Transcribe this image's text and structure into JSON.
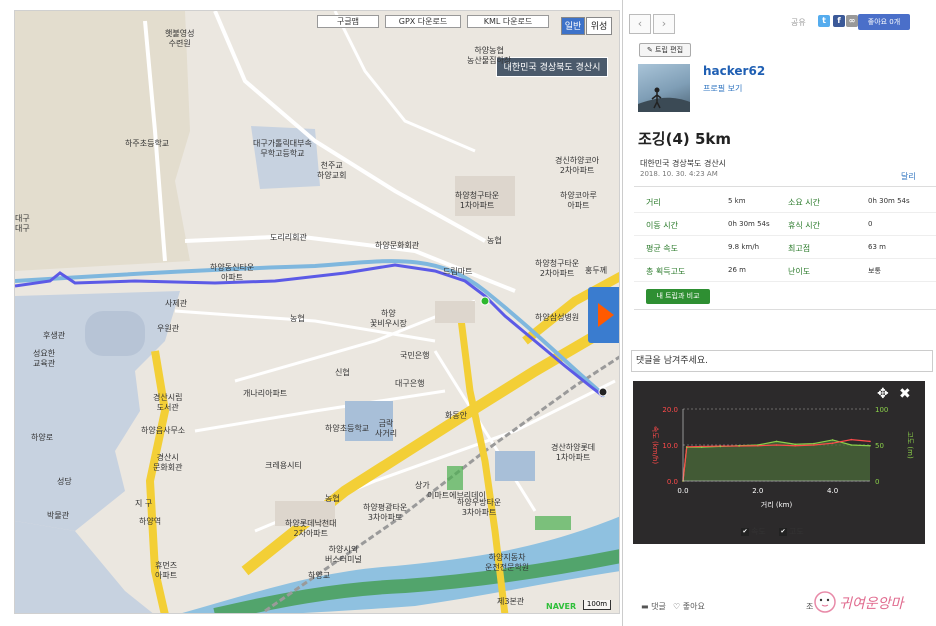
{
  "map": {
    "top_buttons": [
      "구글맵",
      "GPX 다운로드",
      "KML 다운로드"
    ],
    "map_types": [
      "일반",
      "위성"
    ],
    "selected_type": "일반",
    "popup": "대한민국 경상북도 경산시",
    "naver": "NAVER",
    "scale": "100m",
    "labels": [
      "햇불영성\n수련원",
      "하양농협\n농산물집하장",
      "하주초등학교",
      "대구가톨릭대부속\n무학고등학교",
      "천주교\n하양교회",
      "경신하양코아\n2차아파트",
      "하양청구타운\n1차아파트",
      "하양코아루\n아파트",
      "도리리회관",
      "하양문화회관",
      "농협",
      "하양청구타운\n2차아파트",
      "홍두께",
      "하양동신타운\n아파트",
      "드림마트",
      "하양삼성병원",
      "사제관",
      "농협",
      "후생관",
      "우원관",
      "하양\n꽃비우시장",
      "국민은행",
      "성요한\n교육관",
      "신협",
      "대구은행",
      "개나리아파트",
      "경산시립\n도서관",
      "하양읍사무소",
      "하양초등학교",
      "경산시\n문화회관",
      "크레용시티",
      "경산하양롯데\n1차아파트",
      "이마트에브리데이",
      "농협",
      "하양우방타운\n3차아파트",
      "하양역",
      "하양롯데낙천대\n2차아파트",
      "하양평광타운\n3차아파트",
      "하양시외\n버스터미널",
      "휴먼즈\n아파트",
      "하양교",
      "하양지동차\n운전전문학원",
      "제3본관",
      "성당",
      "박물관",
      "지 구",
      "대구\n대구",
      "하양로",
      "금락\n사거리",
      "화동안",
      "상가"
    ]
  },
  "panel": {
    "share_label": "공유",
    "like_label": "좋아요 0개",
    "edit_label": "트립 편집",
    "username": "hacker62",
    "profile_link": "프로필 보기",
    "title": "조깅(4) 5km",
    "location": "대한민국 경상북도 경산시",
    "datetime": "2018. 10. 30. 4:23 AM",
    "more": "달리",
    "stats": [
      {
        "label": "거리",
        "value": "5 km",
        "label2": "소요 시간",
        "value2": "0h 30m 54s"
      },
      {
        "label": "이동 시간",
        "value": "0h 30m 54s",
        "label2": "휴식 시간",
        "value2": "0"
      },
      {
        "label": "평균 속도",
        "value": "9.8 km/h",
        "label2": "최고점",
        "value2": "63 m"
      },
      {
        "label": "총 획득고도",
        "value": "26 m",
        "label2": "난이도",
        "value2": "보통"
      }
    ],
    "compare_label": "내 트립과 비교",
    "comment_placeholder": "댓글을 남겨주세요.",
    "legend": [
      "속도",
      "고도"
    ],
    "footer": [
      "댓글",
      "좋아요",
      "조"
    ],
    "watermark": "귀여운앙마"
  },
  "chart_data": {
    "type": "line",
    "xlabel": "거리 (km)",
    "ylabel_left": "속도 (km/h)",
    "ylabel_right": "고도 (m)",
    "x_ticks": [
      0.0,
      2.0,
      4.0
    ],
    "y_left_ticks": [
      0.0,
      10.0,
      20.0
    ],
    "y_right_ticks": [
      0,
      50,
      100
    ],
    "x": [
      0.0,
      0.1,
      0.5,
      1.0,
      1.5,
      2.0,
      2.5,
      3.0,
      3.5,
      4.0,
      4.5,
      5.0
    ],
    "series": [
      {
        "name": "속도",
        "color": "#ff4a4a",
        "axis": "left",
        "values": [
          0,
          9.5,
          9.6,
          9.7,
          9.7,
          9.8,
          10.0,
          9.8,
          10.0,
          10.5,
          11.5,
          11.0
        ]
      },
      {
        "name": "고도",
        "color": "#8bd04a",
        "axis": "right",
        "values": [
          0,
          47,
          47,
          48,
          49,
          50,
          55,
          51,
          52,
          57,
          50,
          49
        ]
      }
    ],
    "colors": {
      "speed": "#ff4a4a",
      "elevation": "#8bd04a",
      "background": "#2c2a2b"
    }
  }
}
